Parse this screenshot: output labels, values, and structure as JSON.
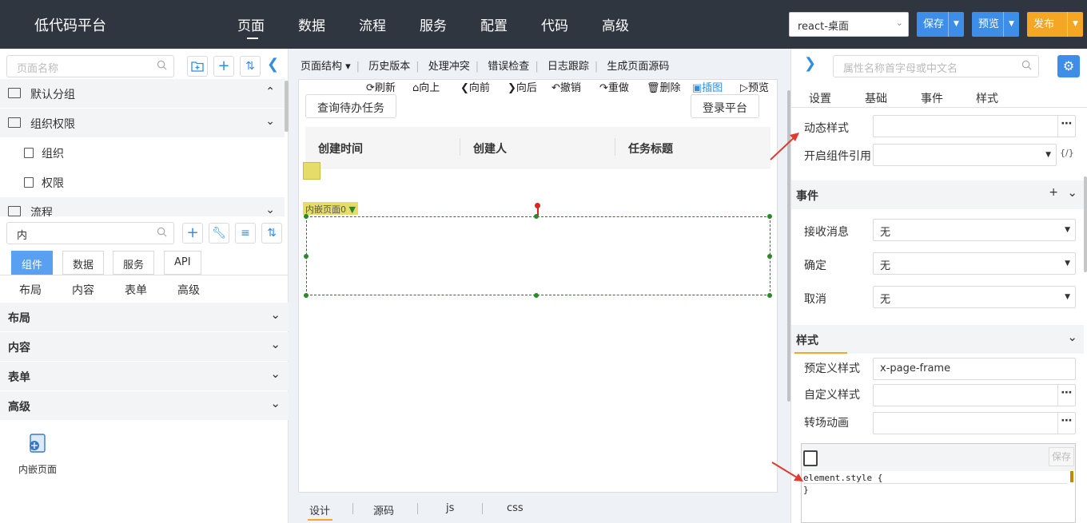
{
  "header": {
    "title": "低代码平台",
    "nav": [
      "页面",
      "数据",
      "流程",
      "服务",
      "配置",
      "代码",
      "高级"
    ],
    "active_nav": "页面",
    "platform_select": "react-桌面",
    "save": "保存",
    "preview": "预览",
    "publish": "发布",
    "colors": {
      "bar": "#2f3640",
      "save": "#3d8ee8",
      "preview": "#3d8ee8",
      "publish": "#f5a623"
    }
  },
  "left": {
    "page_search_placeholder": "页面名称",
    "groups": [
      {
        "label": "默认分组",
        "expanded": true
      },
      {
        "label": "组织权限",
        "expanded": true,
        "pages": [
          "组织",
          "权限"
        ]
      },
      {
        "label": "流程",
        "expanded": false
      }
    ],
    "component_search_value": "内",
    "tabs": [
      "组件",
      "数据",
      "服务",
      "API"
    ],
    "active_tab": "组件",
    "subcats": [
      "布局",
      "内容",
      "表单",
      "高级"
    ],
    "categories": [
      "布局",
      "内容",
      "表单",
      "高级"
    ],
    "component_item": "内嵌页面"
  },
  "center": {
    "menu": [
      "页面结构 ▾",
      "历史版本",
      "处理冲突",
      "错误检查",
      "日志跟踪",
      "生成页面源码"
    ],
    "actions": [
      "刷新",
      "向上",
      "向前",
      "向后",
      "撤销",
      "重做",
      "删除",
      "插图",
      "预览"
    ],
    "query_button": "查询待办任务",
    "login_button": "登录平台",
    "columns": [
      "创建时间",
      "创建人",
      "任务标题"
    ],
    "embed_label": "内嵌页面0",
    "bottom_tabs": [
      "设计",
      "源码",
      "js",
      "css"
    ],
    "active_bottom_tab": "设计"
  },
  "right": {
    "search_placeholder": "属性名称首字母或中文名",
    "tabs": [
      "设置",
      "基础",
      "事件",
      "样式"
    ],
    "dynamic_style_label": "动态样式",
    "component_ref_label": "开启组件引用",
    "events_section": "事件",
    "events": [
      {
        "label": "接收消息",
        "value": "无"
      },
      {
        "label": "确定",
        "value": "无"
      },
      {
        "label": "取消",
        "value": "无"
      }
    ],
    "style_section": "样式",
    "predefined_style_label": "预定义样式",
    "predefined_style_value": "x-page-frame",
    "custom_style_label": "自定义样式",
    "transition_label": "转场动画",
    "code_save": "保存",
    "code_line1": "element.style {",
    "code_line2": "}"
  }
}
